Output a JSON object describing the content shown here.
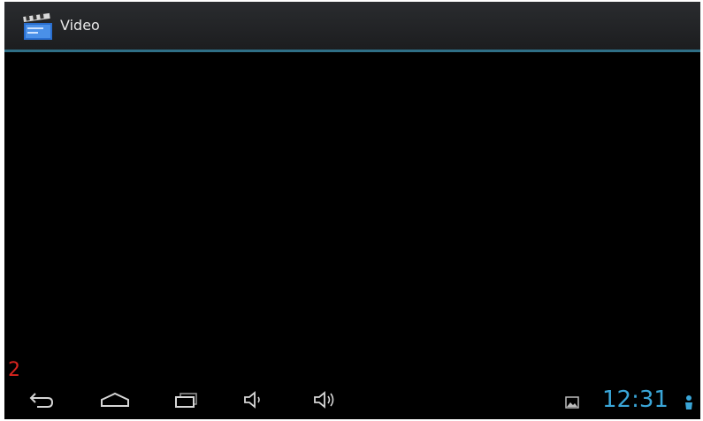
{
  "app": {
    "title": "Video",
    "icon": "video-clapperboard-icon"
  },
  "overlay": {
    "number": "2"
  },
  "system_bar": {
    "clock": "12:31",
    "nav_buttons": [
      "back-icon",
      "home-icon",
      "recent-apps-icon",
      "volume-down-icon",
      "volume-up-icon"
    ],
    "notifications": [
      "gallery-notification-icon",
      "usb-notification-icon"
    ]
  },
  "colors": {
    "action_bar": "#1f2023",
    "accent_divider": "#2f6f86",
    "clock": "#3aa6d8",
    "overlay_number": "#d8241e",
    "background": "#000000"
  }
}
